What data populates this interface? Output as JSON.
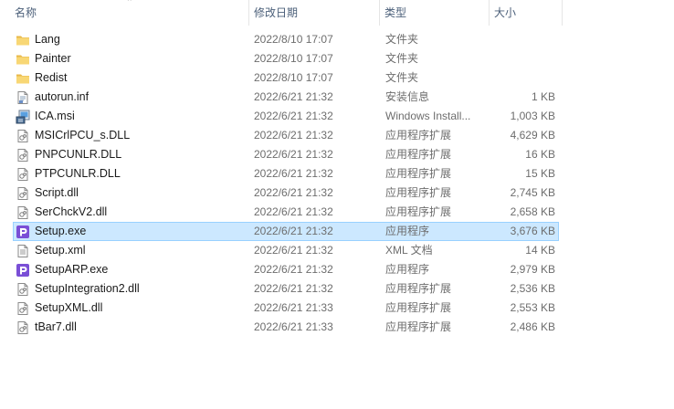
{
  "columns": {
    "name": "名称",
    "date": "修改日期",
    "type": "类型",
    "size": "大小"
  },
  "files": [
    {
      "name": "Lang",
      "date": "2022/8/10 17:07",
      "type": "文件夹",
      "size": "",
      "icon": "folder-icon"
    },
    {
      "name": "Painter",
      "date": "2022/8/10 17:07",
      "type": "文件夹",
      "size": "",
      "icon": "folder-icon"
    },
    {
      "name": "Redist",
      "date": "2022/8/10 17:07",
      "type": "文件夹",
      "size": "",
      "icon": "folder-icon"
    },
    {
      "name": "autorun.inf",
      "date": "2022/6/21 21:32",
      "type": "安装信息",
      "size": "1 KB",
      "icon": "inf-file-icon"
    },
    {
      "name": "ICA.msi",
      "date": "2022/6/21 21:32",
      "type": "Windows Install...",
      "size": "1,003 KB",
      "icon": "msi-installer-icon"
    },
    {
      "name": "MSICrlPCU_s.DLL",
      "date": "2022/6/21 21:32",
      "type": "应用程序扩展",
      "size": "4,629 KB",
      "icon": "dll-file-icon"
    },
    {
      "name": "PNPCUNLR.DLL",
      "date": "2022/6/21 21:32",
      "type": "应用程序扩展",
      "size": "16 KB",
      "icon": "dll-file-icon"
    },
    {
      "name": "PTPCUNLR.DLL",
      "date": "2022/6/21 21:32",
      "type": "应用程序扩展",
      "size": "15 KB",
      "icon": "dll-file-icon"
    },
    {
      "name": "Script.dll",
      "date": "2022/6/21 21:32",
      "type": "应用程序扩展",
      "size": "2,745 KB",
      "icon": "dll-file-icon"
    },
    {
      "name": "SerChckV2.dll",
      "date": "2022/6/21 21:32",
      "type": "应用程序扩展",
      "size": "2,658 KB",
      "icon": "dll-file-icon"
    },
    {
      "name": "Setup.exe",
      "date": "2022/6/21 21:32",
      "type": "应用程序",
      "size": "3,676 KB",
      "icon": "app-exe-icon",
      "selected": true
    },
    {
      "name": "Setup.xml",
      "date": "2022/6/21 21:32",
      "type": "XML 文档",
      "size": "14 KB",
      "icon": "xml-file-icon"
    },
    {
      "name": "SetupARP.exe",
      "date": "2022/6/21 21:32",
      "type": "应用程序",
      "size": "2,979 KB",
      "icon": "app-exe-icon"
    },
    {
      "name": "SetupIntegration2.dll",
      "date": "2022/6/21 21:32",
      "type": "应用程序扩展",
      "size": "2,536 KB",
      "icon": "dll-file-icon"
    },
    {
      "name": "SetupXML.dll",
      "date": "2022/6/21 21:33",
      "type": "应用程序扩展",
      "size": "2,553 KB",
      "icon": "dll-file-icon"
    },
    {
      "name": "tBar7.dll",
      "date": "2022/6/21 21:33",
      "type": "应用程序扩展",
      "size": "2,486 KB",
      "icon": "dll-file-icon"
    }
  ],
  "colors": {
    "selection_bg": "#cce8ff",
    "selection_border": "#99d1ff",
    "folder": "#f8d775",
    "exe_purple": "#7a4fd6"
  }
}
